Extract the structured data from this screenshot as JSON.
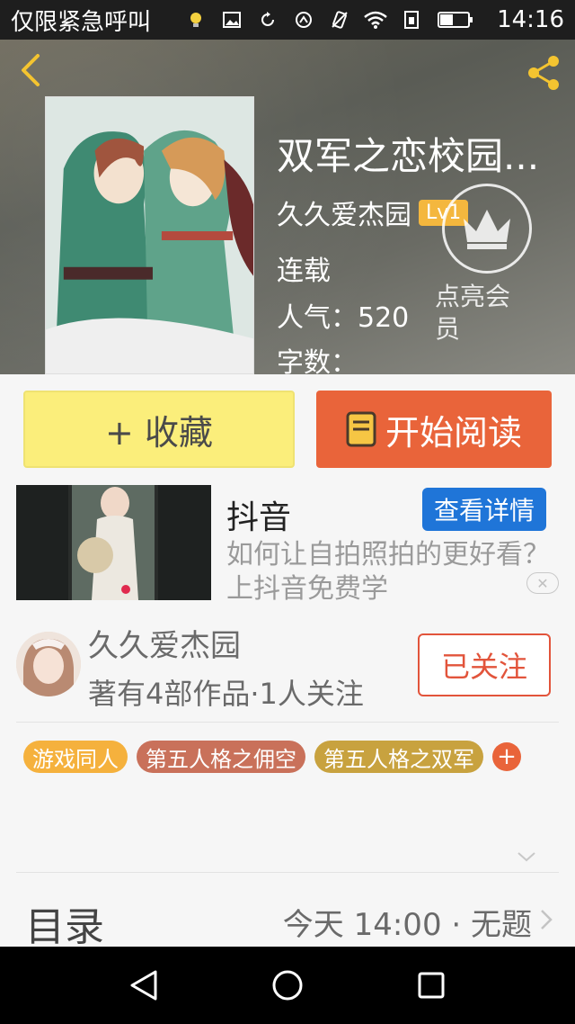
{
  "status_bar": {
    "carrier_text": "仅限紧急呼叫",
    "time": "14:16",
    "icons": [
      "bulb-icon",
      "image-icon",
      "sync-icon",
      "nfc-icon",
      "vibrate-icon",
      "wifi-icon",
      "sim-icon",
      "battery-icon"
    ]
  },
  "book": {
    "title": "双军之恋校园...",
    "author": "久久爱杰园",
    "level": "Lv1",
    "status": "连载",
    "popularity": "人气：520",
    "word_count": "字数：",
    "member_label": "点亮会员"
  },
  "actions": {
    "favorite": "+ 收藏",
    "start_reading": "开始阅读"
  },
  "ad": {
    "title": "抖音",
    "detail_button": "查看详情",
    "description": "如何让自拍照拍的更好看？上抖音免费学",
    "close": "✕"
  },
  "author_card": {
    "name": "久久爱杰园",
    "stats": "著有4部作品·1人关注",
    "follow_button": "已关注"
  },
  "tags": [
    {
      "label": "游戏同人",
      "color": "#f5b13d"
    },
    {
      "label": "第五人格之佣空",
      "color": "#c9715a"
    },
    {
      "label": "第五人格之双军",
      "color": "#c8a23f"
    }
  ],
  "tag_add": "+",
  "catalog": {
    "title": "目录",
    "latest": "今天 14:00 · 无题"
  },
  "colors": {
    "accent_orange": "#e9643a",
    "favorite_yellow": "#fbee7b",
    "ad_blue": "#1f75d8",
    "follow_red": "#e2543b",
    "badge_gold": "#f4b73e"
  }
}
